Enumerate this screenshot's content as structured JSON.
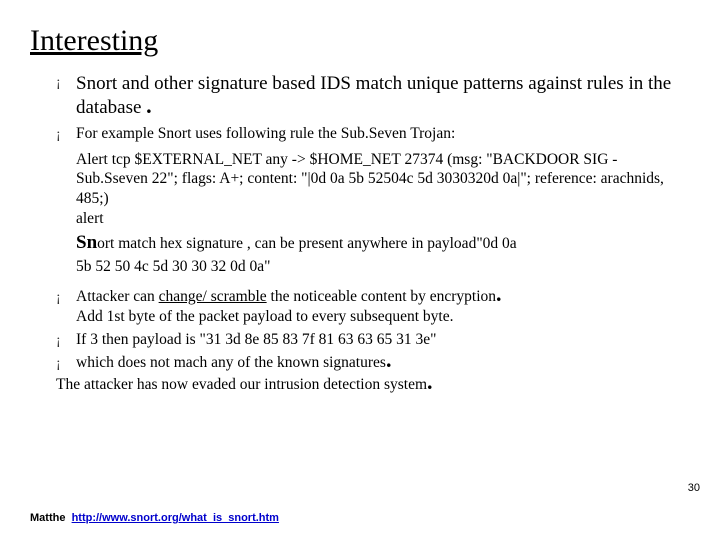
{
  "title": "Interesting",
  "b1": "Snort and other signature based IDS  match unique patterns against rules in the database",
  "dot": ".",
  "b2": "For example Snort uses following rule the Sub.Seven Trojan:",
  "rule1": "Alert tcp $EXTERNAL_NET any -> $HOME_NET 27374 (msg: \"BACKDOOR SIG - Sub.Sseven 22\"; flags: A+; content: \"|0d 0a 5b 52504c 5d 3030320d 0a|\"; reference: arachnids, 485;)",
  "rule2": "alert",
  "sn_prefix": "Sn",
  "sn_rest": "ort match  hex signature , can be present anywhere in payload\"0d 0a",
  "hexline": "5b 52 50 4c 5d 30 30 32 0d 0a\"",
  "b3_pre": "Attacker  can  ",
  "b3_ul": "change/ scramble",
  "b3_post": " the  noticeable content by encryption",
  "b3_line2": "Add 1st byte of the packet payload to every subsequent byte.",
  "b4": "If   3 then  payload  is  \"31 3d 8e 85 83 7f 81 63 63 65 31 3e\"",
  "b5": "which does not mach any of the known signatures",
  "tail": "The attacker has now evaded our intrusion detection system",
  "footer_author": "Matthe",
  "footer_link_text": "http://www.snort.org/what_is_snort.htm",
  "footer_link_href": "http://www.snort.org/what_is_snort.htm",
  "page": "30"
}
